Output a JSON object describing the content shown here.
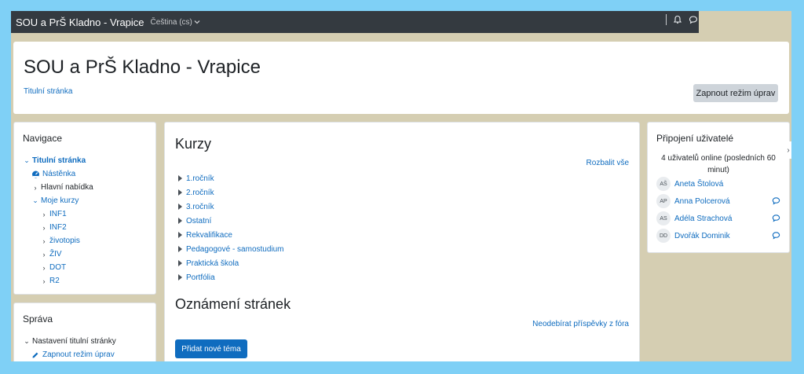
{
  "navbar": {
    "site_name": "SOU a PrŠ Kladno - Vrapice",
    "language": "Čeština (cs)"
  },
  "header": {
    "title": "SOU a PrŠ Kladno - Vrapice",
    "breadcrumb": "Titulní stránka",
    "edit_button": "Zapnout režim úprav"
  },
  "navigation": {
    "title": "Navigace",
    "items": [
      {
        "label": "Titulní stránka"
      },
      {
        "label": "Nástěnka"
      },
      {
        "label": "Hlavní nabídka"
      },
      {
        "label": "Moje kurzy"
      },
      {
        "label": "INF1"
      },
      {
        "label": "INF2"
      },
      {
        "label": "životopis"
      },
      {
        "label": "ŽIV"
      },
      {
        "label": "DOT"
      },
      {
        "label": "R2"
      }
    ]
  },
  "admin": {
    "title": "Správa",
    "items": [
      {
        "label": "Nastavení titulní stránky"
      },
      {
        "label": "Zapnout režim úprav"
      }
    ]
  },
  "courses": {
    "title": "Kurzy",
    "expand_all": "Rozbalit vše",
    "categories": [
      "1.ročník",
      "2.ročník",
      "3.ročník",
      "Ostatní",
      "Rekvalifikace",
      "Pedagogové - samostudium",
      "Praktická škola",
      "Portfólia"
    ]
  },
  "news": {
    "title": "Oznámení stránek",
    "unsubscribe": "Neodebírat příspěvky z fóra",
    "add_topic": "Přidat nové téma"
  },
  "online_users": {
    "title": "Připojení uživatelé",
    "info": "4 uživatelů online (posledních 60 minut)",
    "users": [
      {
        "initials": "AŠ",
        "name": "Aneta Štolová"
      },
      {
        "initials": "AP",
        "name": "Anna Polcerová"
      },
      {
        "initials": "AS",
        "name": "Adéla Strachová"
      },
      {
        "initials": "DD",
        "name": "Dvořák Dominik"
      }
    ]
  },
  "colors": {
    "navbar": "#343a40",
    "link": "#0f6cbf",
    "page_background": "#d5ceb2",
    "outer_border": "#7fd0f6"
  }
}
